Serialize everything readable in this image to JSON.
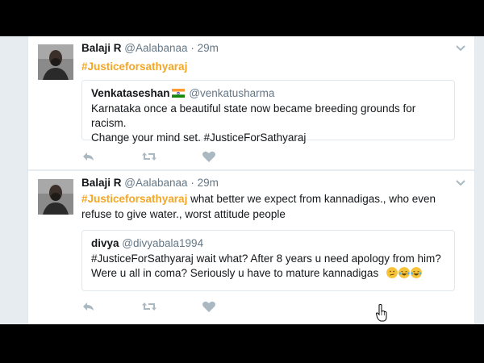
{
  "tweets": [
    {
      "name": "Balaji R",
      "handle": "@Aalabanaa",
      "dot": "·",
      "time": "29m",
      "hashtag": "#Justiceforsathyaraj",
      "text_rest": "",
      "quote": {
        "name": "Venkataseshan",
        "handle": "@venkatusharma",
        "line1": "Karnataka once a beautiful state now became breeding grounds for racism.",
        "line2": "Change your mind set. #JusticeForSathyaraj"
      }
    },
    {
      "name": "Balaji R",
      "handle": "@Aalabanaa",
      "dot": "·",
      "time": "29m",
      "hashtag": "#Justiceforsathyaraj",
      "text_rest": " what better we expect from kannadigas., who even",
      "text_line2": "refuse to give water., worst attitude people",
      "quote": {
        "name": "divya",
        "handle": "@divyabala1994",
        "line1": "#JusticeForSathyaraj wait what?  After 8 years u need apology from him?",
        "line2": "Were u all in coma?  Seriously u have to mature kannadigas"
      }
    }
  ],
  "icons": {
    "reply": "reply-icon",
    "retweet": "retweet-icon",
    "like": "heart-icon",
    "menu": "chevron-down-icon",
    "flag": "india-flag-icon",
    "cursor": "hand-pointer-icon",
    "emojis": [
      "confused-face-icon",
      "laughing-tears-icon",
      "laughing-tears-icon"
    ]
  },
  "colors": {
    "hashtag": "#f5a623",
    "text": "#14171a",
    "secondary": "#657786",
    "icon": "#aab8c2",
    "border": "#e1e8ed",
    "background": "#e6ecf0"
  }
}
